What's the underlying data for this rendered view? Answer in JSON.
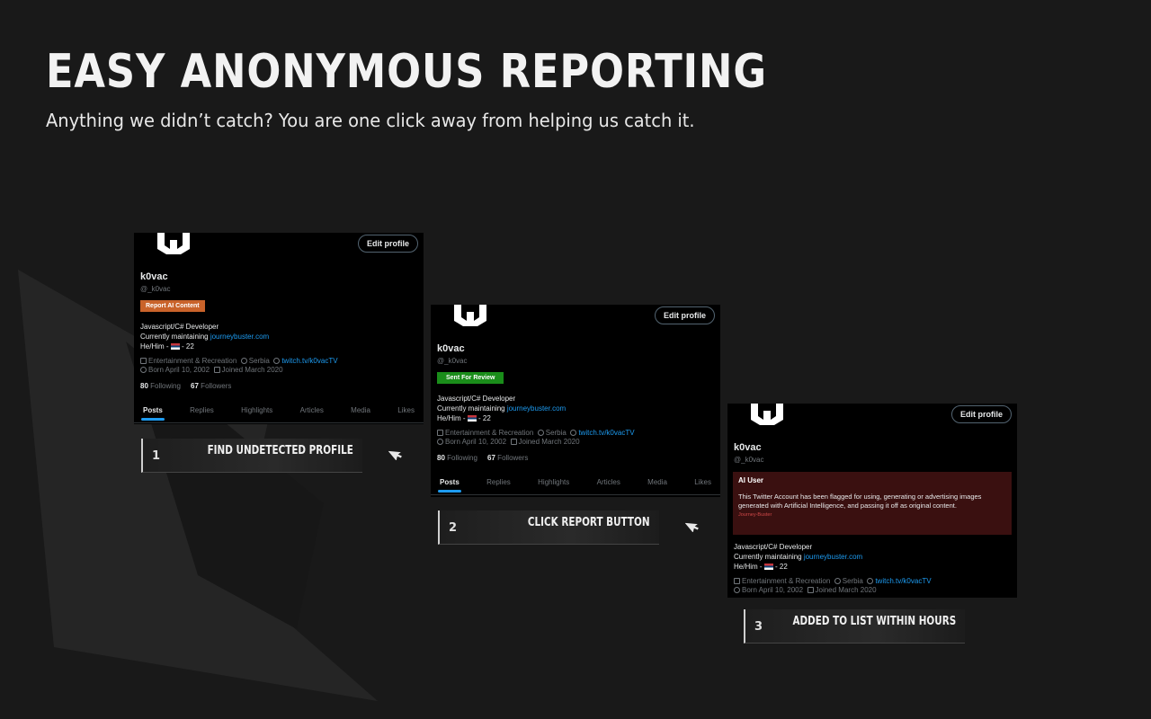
{
  "header": {
    "title": "EASY ANONYMOUS REPORTING",
    "subtitle": "Anything we didn’t catch? You are one click away from helping us catch it."
  },
  "profile": {
    "edit_label": "Edit profile",
    "name": "k0vac",
    "handle": "@_k0vac",
    "bio_line1": "Javascript/C# Developer",
    "bio_line2_prefix": "Currently maintaining ",
    "bio_link": "journeybuster.com",
    "bio_line3_prefix": "He/Him - ",
    "bio_line3_suffix": " - 22",
    "category": "Entertainment & Recreation",
    "location": "Serbia",
    "website": "twitch.tv/k0vacTV",
    "born": "Born April 10, 2002",
    "joined": "Joined March 2020",
    "following_count": "80",
    "following_label": " Following",
    "followers_count": "67",
    "followers_label": " Followers",
    "tabs": [
      "Posts",
      "Replies",
      "Highlights",
      "Articles",
      "Media",
      "Likes"
    ]
  },
  "cards": {
    "report_badge": "Report AI Content",
    "review_badge": "Sent For Review",
    "ai_title": "AI User",
    "ai_description": "This Twitter Account has been flagged for using, generating or advertising images generated with Artificial Intelligence, and passing it off as original content.",
    "ai_source": "Journey-Buster"
  },
  "steps": [
    {
      "number": "1",
      "label": "FIND UNDETECTED PROFILE"
    },
    {
      "number": "2",
      "label": "CLICK REPORT BUTTON"
    },
    {
      "number": "3",
      "label": "ADDED TO LIST WITHIN HOURS"
    }
  ],
  "colors": {
    "background": "#191919",
    "report_orange": "#c9632a",
    "review_green": "#1a8d1a",
    "link_blue": "#1d9bf0",
    "ai_box": "#3a1010"
  },
  "icons": {
    "avatar": "logo-avatar-icon",
    "pointer": "mouse-pointer-icon"
  }
}
